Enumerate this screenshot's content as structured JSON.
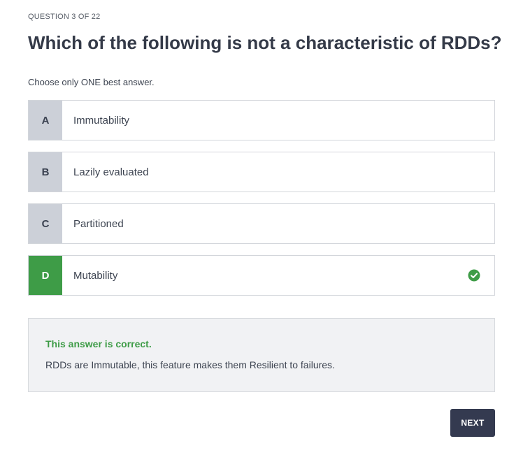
{
  "quiz": {
    "counter": "QUESTION 3 OF 22",
    "question": "Which of the following is not a characteristic of RDDs?",
    "instruction": "Choose only ONE best answer."
  },
  "options": [
    {
      "letter": "A",
      "label": "Immutability",
      "correct": false
    },
    {
      "letter": "B",
      "label": "Lazily evaluated",
      "correct": false
    },
    {
      "letter": "C",
      "label": "Partitioned",
      "correct": false
    },
    {
      "letter": "D",
      "label": "Mutability",
      "correct": true,
      "icon": "check-circle-icon"
    }
  ],
  "feedback": {
    "title": "This answer is correct.",
    "body": "RDDs are Immutable, this feature makes them Resilient to failures."
  },
  "actions": {
    "next_label": "NEXT"
  },
  "colors": {
    "correct_green": "#3e9c47",
    "letter_gray": "#ccd0d8",
    "button_dark": "#343a50"
  }
}
